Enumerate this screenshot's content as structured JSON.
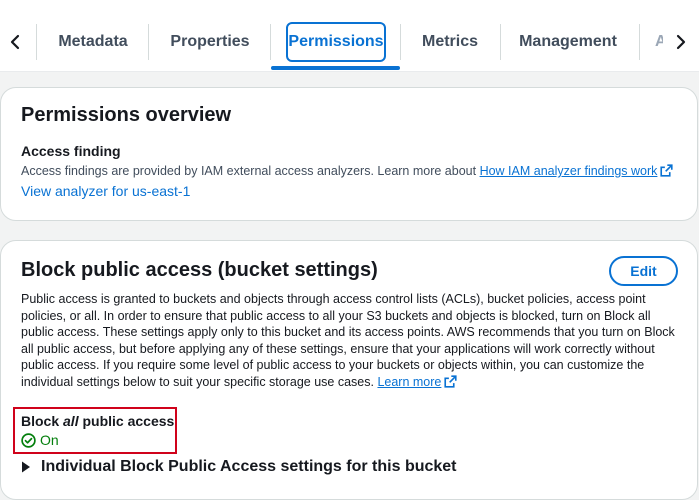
{
  "tabs": {
    "items": [
      "Metadata",
      "Properties",
      "Permissions",
      "Metrics",
      "Management"
    ],
    "active": "Permissions",
    "partial_next": "A"
  },
  "overview": {
    "title": "Permissions overview",
    "access_finding_label": "Access finding",
    "description": "Access findings are provided by IAM external access analyzers. Learn more about ",
    "learn_link": "How IAM analyzer findings work",
    "view_link": "View analyzer for us-east-1"
  },
  "block_public_access": {
    "title": "Block public access (bucket settings)",
    "edit_label": "Edit",
    "paragraph": "Public access is granted to buckets and objects through access control lists (ACLs), bucket policies, access point policies, or all. In order to ensure that public access to all your S3 buckets and objects is blocked, turn on Block all public access. These settings apply only to this bucket and its access points. AWS recommends that you turn on Block all public access, but before applying any of these settings, ensure that your applications will work correctly without public access. If you require some level of public access to your buckets or objects within, you can customize the individual settings below to suit your specific storage use cases.",
    "learn_more": "Learn more",
    "block_all_prefix": "Block ",
    "block_all_emph": "all",
    "block_all_suffix": " public access",
    "status": "On",
    "expander_label": "Individual Block Public Access settings for this bucket"
  },
  "colors": {
    "accent": "#0972d3",
    "success": "#037f0c",
    "highlight": "#d0021b"
  }
}
